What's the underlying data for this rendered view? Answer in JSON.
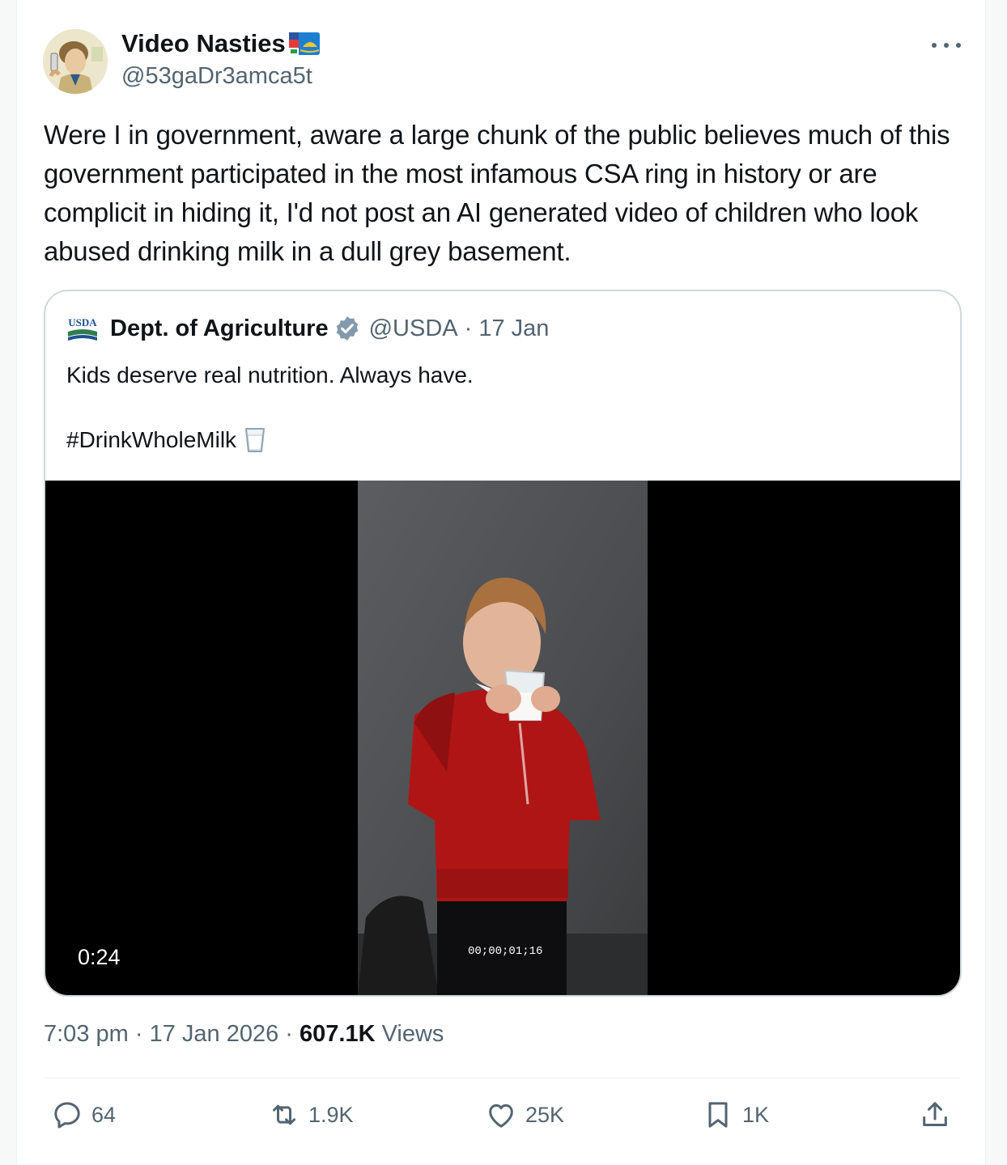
{
  "author": {
    "name": "Video Nasties",
    "handle": "@53gaDr3amca5t"
  },
  "tweet": {
    "text": "Were I in government, aware a large chunk of the public believes much of this government participated in the most infamous CSA ring in history or are complicit in hiding it, I'd not post an AI generated video of children who look abused drinking milk in a dull grey basement."
  },
  "quoted": {
    "logo_text": "USDA",
    "name": "Dept. of Agriculture",
    "handle": "@USDA",
    "date": "· 17 Jan",
    "text": "Kids deserve real nutrition. Always have.",
    "hashtag": "#DrinkWholeMilk",
    "video": {
      "duration": "0:24",
      "timecode": "00;00;01;16"
    }
  },
  "meta": {
    "time": "7:03 pm",
    "date": "17 Jan 2026",
    "views_count": "607.1K",
    "views_label": "Views"
  },
  "actions": {
    "replies": "64",
    "reposts": "1.9K",
    "likes": "25K",
    "bookmarks": "1K"
  },
  "icons": {
    "more": "more-icon",
    "verified": "verified-badge-icon",
    "milk": "milk-glass-icon",
    "reply": "reply-icon",
    "repost": "repost-icon",
    "like": "like-icon",
    "bookmark": "bookmark-icon",
    "share": "share-icon"
  },
  "colors": {
    "text": "#0f1419",
    "secondary": "#536471",
    "verified": "#829aab",
    "border": "#cfd9de",
    "sweater": "#b01515"
  }
}
